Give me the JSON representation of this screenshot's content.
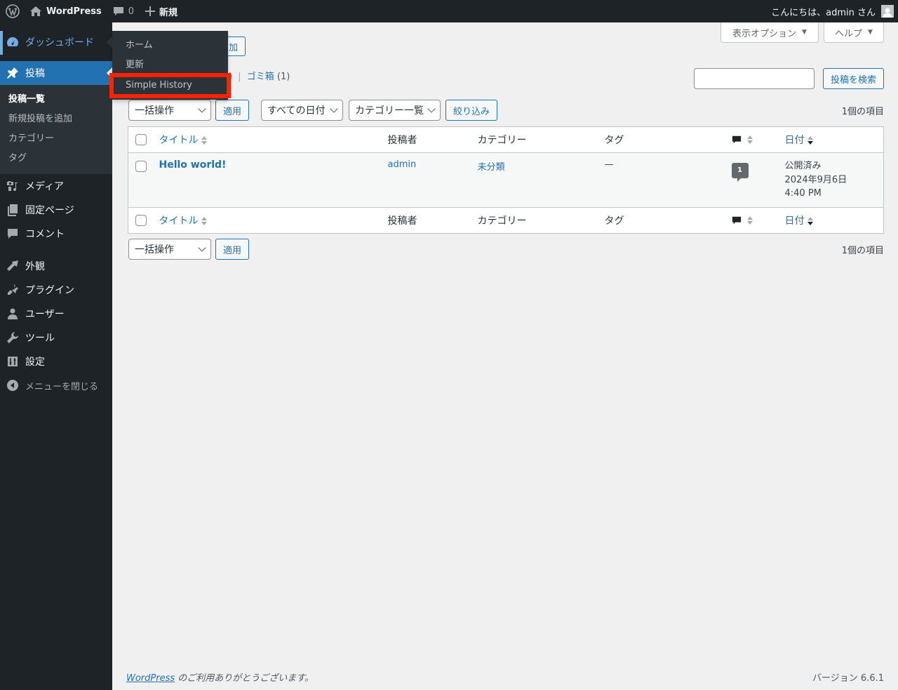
{
  "adminbar": {
    "site_name": "WordPress",
    "comments_count": "0",
    "new_label": "新規",
    "greeting": "こんにちは、admin さん"
  },
  "sidebar": {
    "items": [
      {
        "label": "ダッシュボード",
        "icon": "dashboard-icon"
      },
      {
        "label": "投稿",
        "icon": "pin-icon"
      },
      {
        "label": "メディア",
        "icon": "media-icon"
      },
      {
        "label": "固定ページ",
        "icon": "pages-icon"
      },
      {
        "label": "コメント",
        "icon": "comment-icon"
      },
      {
        "label": "外観",
        "icon": "brush-icon"
      },
      {
        "label": "プラグイン",
        "icon": "plugin-icon"
      },
      {
        "label": "ユーザー",
        "icon": "user-icon"
      },
      {
        "label": "ツール",
        "icon": "wrench-icon"
      },
      {
        "label": "設定",
        "icon": "settings-icon"
      }
    ],
    "posts_submenu": [
      "投稿一覧",
      "新規投稿を追加",
      "カテゴリー",
      "タグ"
    ],
    "collapse_label": "メニューを閉じる"
  },
  "flyout": {
    "items": [
      "ホーム",
      "更新",
      "Simple History"
    ],
    "highlighted": "Simple History",
    "highlight_color": "#ff2200"
  },
  "screen_meta": {
    "options_label": "表示オプション",
    "help_label": "ヘルプ"
  },
  "main": {
    "add_new_partial": "加",
    "subsubsub_partial": ")",
    "trash_label": "ゴミ箱",
    "trash_count": "(1)",
    "search_value": "",
    "search_button": "投稿を検索",
    "bulk_action": "一括操作",
    "apply": "適用",
    "date_filter": "すべての日付",
    "category_filter": "カテゴリー一覧",
    "filter_button": "絞り込み",
    "items_count": "1個の項目"
  },
  "table": {
    "columns": {
      "title": "タイトル",
      "author": "投稿者",
      "categories": "カテゴリー",
      "tags": "タグ",
      "date": "日付"
    },
    "rows": [
      {
        "title": "Hello world!",
        "author": "admin",
        "category": "未分類",
        "tags": "—",
        "comments": "1",
        "status": "公開済み",
        "date": "2024年9月6日 4:40 PM"
      }
    ]
  },
  "footer": {
    "wp_link": "WordPress",
    "thanks": " のご利用ありがとうございます。",
    "version": "バージョン 6.6.1"
  },
  "colors": {
    "accent": "#2271b1",
    "sidebar_bg": "#1d2327",
    "highlight": "#ff2200"
  }
}
